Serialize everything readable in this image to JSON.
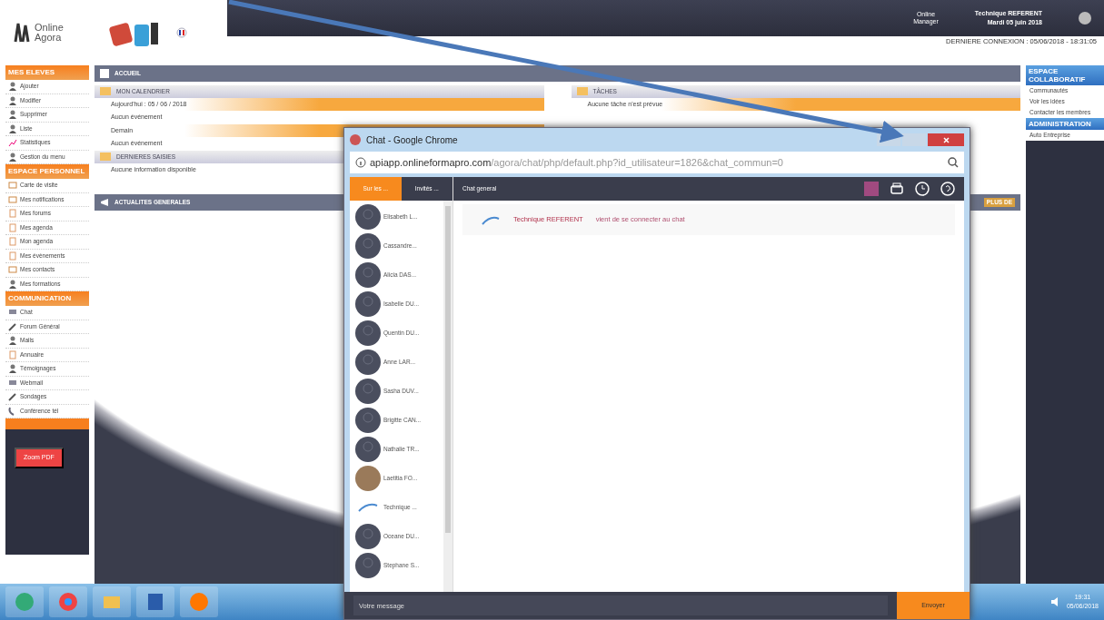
{
  "header": {
    "logo_text": [
      "Online",
      "Agora"
    ],
    "product": [
      "Online",
      "Manager"
    ],
    "user": "Technique REFERENT",
    "date": "Mardi 05 juin 2018",
    "sub_link": "DERNIERE CONNEXION : 05/06/2018 - 18:31:05"
  },
  "left_sidebar": [
    {
      "title": "MES ELEVES",
      "items": [
        {
          "label": "Ajouter",
          "kind": "person"
        },
        {
          "label": "Modifier",
          "kind": "person"
        },
        {
          "label": "Supprimer",
          "kind": "person"
        },
        {
          "label": "Liste",
          "kind": "person"
        },
        {
          "label": "Statistiques",
          "kind": "chart"
        },
        {
          "label": "Gestion du menu",
          "kind": "person"
        }
      ]
    },
    {
      "title": "ESPACE PERSONNEL",
      "items": [
        {
          "label": "Carte de visite",
          "kind": "card"
        },
        {
          "label": "Mes notifications",
          "kind": "card"
        },
        {
          "label": "Mes forums",
          "kind": "doc"
        },
        {
          "label": "Mes agenda",
          "kind": "doc"
        },
        {
          "label": "Mon agenda",
          "kind": "doc"
        },
        {
          "label": "Mes évènements",
          "kind": "doc"
        },
        {
          "label": "Mes contacts",
          "kind": "card"
        },
        {
          "label": "Mes formations",
          "kind": "person"
        }
      ]
    },
    {
      "title": "COMMUNICATION",
      "items": [
        {
          "label": "Chat",
          "kind": "chat"
        },
        {
          "label": "Forum Général",
          "kind": "pen"
        },
        {
          "label": "Mails",
          "kind": "person"
        },
        {
          "label": "Annuaire",
          "kind": "doc"
        },
        {
          "label": "Témoignages",
          "kind": "person"
        },
        {
          "label": "Webmail",
          "kind": "chat"
        },
        {
          "label": "Sondages",
          "kind": "pen"
        },
        {
          "label": "Conférence tél",
          "kind": "phone"
        }
      ]
    }
  ],
  "promo": "Zoom PDF",
  "home": {
    "title": "ACCUEIL",
    "calendar": {
      "title": "MON CALENDRIER",
      "rows": [
        {
          "label": "Aujourd'hui : 05 / 06 / 2018",
          "highlight": true
        },
        {
          "label": "Aucun événement",
          "highlight": false
        },
        {
          "label": "Demain",
          "highlight": true
        },
        {
          "label": "Aucun événement",
          "highlight": false
        }
      ]
    },
    "latest": {
      "title": "DERNIERES SAISIES",
      "text": "Aucune information disponible"
    },
    "tasks": {
      "title": "TÂCHES",
      "text": "Aucune tâche n'est prévue"
    },
    "news": {
      "title": "ACTUALITES GENERALES"
    },
    "more": "PLUS DE"
  },
  "right_sidebar": [
    {
      "title": "ESPACE COLLABORATIF",
      "items": [
        "Communautés",
        "Voir les idées",
        "Contacter les membres"
      ]
    },
    {
      "title": "ADMINISTRATION",
      "items": [
        "Auto Entreprise"
      ]
    }
  ],
  "chat_window": {
    "title": "Chat - Google Chrome",
    "url_host": "apiapp.onlineformapro.com",
    "url_path": "/agora/chat/php/default.php?id_utilisateur=1826&chat_commun=0",
    "tabs": [
      {
        "label": "Sur les ...",
        "selected": true
      },
      {
        "label": "Invités ...",
        "selected": false
      }
    ],
    "contacts": [
      {
        "name": "Elisabeth L...",
        "kind": "default"
      },
      {
        "name": "Cassandre...",
        "kind": "default"
      },
      {
        "name": "Alicia DAS...",
        "kind": "default"
      },
      {
        "name": "Isabelle DU...",
        "kind": "default"
      },
      {
        "name": "Quentin DU...",
        "kind": "default"
      },
      {
        "name": "Anne LAR...",
        "kind": "default"
      },
      {
        "name": "Sasha DUV...",
        "kind": "default"
      },
      {
        "name": "Brigitte CAN...",
        "kind": "default"
      },
      {
        "name": "Nathalie TR...",
        "kind": "default"
      },
      {
        "name": "Laetitia FO...",
        "kind": "photo"
      },
      {
        "name": "Technique ...",
        "kind": "logo"
      },
      {
        "name": "Oceane DU...",
        "kind": "default"
      },
      {
        "name": "Stephane S...",
        "kind": "default"
      }
    ],
    "room": "Chat general",
    "messages": [
      {
        "author": "Technique REFERENT",
        "text": "vient de se connecter au chat"
      }
    ],
    "input_placeholder": "Votre message",
    "send": "Envoyer"
  },
  "taskbar": {
    "time": "19:31",
    "date": "05/06/2018"
  }
}
